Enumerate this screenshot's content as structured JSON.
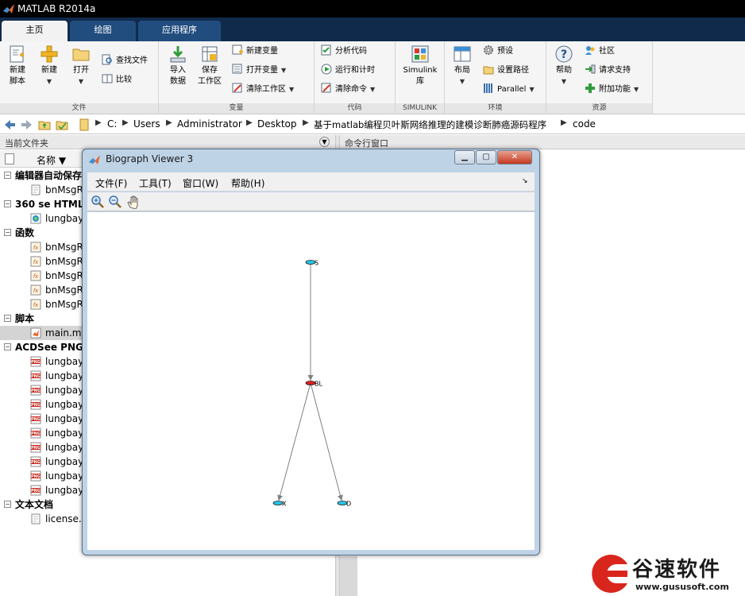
{
  "window": {
    "title": "MATLAB R2014a"
  },
  "tabs": [
    {
      "label": "主页",
      "active": true
    },
    {
      "label": "绘图",
      "active": false
    },
    {
      "label": "应用程序",
      "active": false
    }
  ],
  "ribbon": {
    "file": {
      "label": "文件",
      "new_script": "新建\n脚本",
      "new": "新建",
      "open": "打开",
      "find_files": "查找文件",
      "compare": "比较"
    },
    "variable": {
      "label": "变量",
      "import": "导入\n数据",
      "save_ws": "保存\n工作区",
      "new_var": "新建变量",
      "open_var": "打开变量",
      "clear_ws": "清除工作区"
    },
    "code": {
      "label": "代码",
      "analyze": "分析代码",
      "run_time": "运行和计时",
      "clear_cmd": "清除命令"
    },
    "simulink": {
      "label": "SIMULINK",
      "btn": "Simulink\n库"
    },
    "env": {
      "label": "环境",
      "layout": "布局",
      "prefs": "预设",
      "set_path": "设置路径",
      "parallel": "Parallel"
    },
    "resources": {
      "label": "资源",
      "help": "帮助",
      "community": "社区",
      "support": "请求支持",
      "addons": "附加功能"
    }
  },
  "address": [
    "C:",
    "Users",
    "Administrator",
    "Desktop",
    "基于matlab编程贝叶斯网络推理的建模诊断肺癌源码程序",
    "code"
  ],
  "folder_panel": {
    "title": "当前文件夹",
    "column": "名称 ▼",
    "rows": [
      {
        "type": "group",
        "text": "编辑器自动保存"
      },
      {
        "type": "file",
        "icon": "page",
        "text": "bnMsgR"
      },
      {
        "type": "group",
        "text": "360 se HTML"
      },
      {
        "type": "file",
        "icon": "html",
        "text": "lungbay"
      },
      {
        "type": "group",
        "text": "函数"
      },
      {
        "type": "file",
        "icon": "fx",
        "text": "bnMsgR"
      },
      {
        "type": "file",
        "icon": "fx",
        "text": "bnMsgR"
      },
      {
        "type": "file",
        "icon": "fx",
        "text": "bnMsgR"
      },
      {
        "type": "file",
        "icon": "fx",
        "text": "bnMsgR"
      },
      {
        "type": "file",
        "icon": "fx",
        "text": "bnMsgR"
      },
      {
        "type": "group",
        "text": "脚本"
      },
      {
        "type": "file",
        "icon": "script",
        "text": "main.m",
        "selected": true
      },
      {
        "type": "group",
        "text": "ACDSee PNG"
      },
      {
        "type": "file",
        "icon": "png",
        "text": "lungbay"
      },
      {
        "type": "file",
        "icon": "png",
        "text": "lungbay"
      },
      {
        "type": "file",
        "icon": "png",
        "text": "lungbay"
      },
      {
        "type": "file",
        "icon": "png",
        "text": "lungbay"
      },
      {
        "type": "file",
        "icon": "png",
        "text": "lungbay"
      },
      {
        "type": "file",
        "icon": "png",
        "text": "lungbay"
      },
      {
        "type": "file",
        "icon": "png",
        "text": "lungbay"
      },
      {
        "type": "file",
        "icon": "png",
        "text": "lungbay"
      },
      {
        "type": "file",
        "icon": "png",
        "text": "lungbay"
      },
      {
        "type": "file",
        "icon": "png",
        "text": "lungbay"
      },
      {
        "type": "group",
        "text": "文本文档"
      },
      {
        "type": "file",
        "icon": "page",
        "text": "license.t"
      }
    ]
  },
  "command_panel": {
    "title": "命令行窗口"
  },
  "biograph": {
    "title": "Biograph Viewer 3",
    "menu": [
      "文件(F)",
      "工具(T)",
      "窗口(W)",
      "帮助(H)"
    ],
    "tools": [
      "zoom-in-icon",
      "zoom-out-icon",
      "hand-pan-icon"
    ],
    "graph": {
      "nodes": [
        {
          "id": "S",
          "label": "S",
          "color": "#27c4e8"
        },
        {
          "id": "BL",
          "label": "BL",
          "color": "#e02020"
        },
        {
          "id": "X",
          "label": "X",
          "color": "#27c4e8"
        },
        {
          "id": "D",
          "label": "D",
          "color": "#27c4e8"
        }
      ],
      "edges": [
        {
          "from": "S",
          "to": "BL"
        },
        {
          "from": "BL",
          "to": "X"
        },
        {
          "from": "BL",
          "to": "D"
        }
      ]
    }
  },
  "watermark": {
    "name": "谷速软件",
    "url": "www.gususoft.com"
  }
}
